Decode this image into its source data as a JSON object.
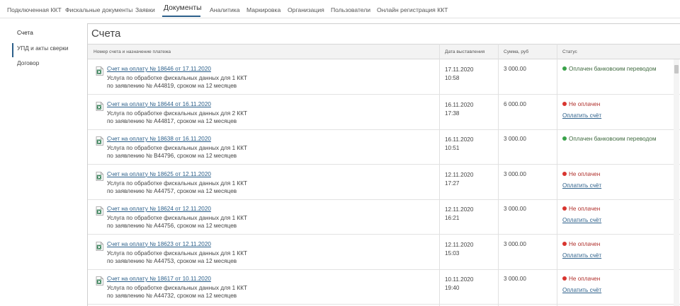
{
  "topnav": {
    "tabs": [
      {
        "label": "Подключенная ККТ"
      },
      {
        "label": "Фискальные документы"
      },
      {
        "label": "Заявки"
      },
      {
        "label": "Документы"
      },
      {
        "label": "Аналитика"
      },
      {
        "label": "Маркировка"
      },
      {
        "label": "Организация"
      },
      {
        "label": "Пользователи"
      },
      {
        "label": "Онлайн регистрация ККТ"
      }
    ],
    "active_tab": "Документы"
  },
  "sidebar": {
    "items": [
      {
        "label": "Счета"
      },
      {
        "label": "УПД и акты сверки"
      },
      {
        "label": "Договор"
      }
    ],
    "active_item": "Счета"
  },
  "main": {
    "title": "Счета",
    "columns": [
      "Номер счета и назначение платежа",
      "Дата выставления",
      "Сумма, руб",
      "Статус"
    ],
    "pay_label": "Оплатить счёт",
    "rows": [
      {
        "invoice": "Счет на оплату № 18646 от 17.11.2020",
        "desc1": "Услуга по обработке фискальных данных для 1 ККТ",
        "desc2": "по заявлению № A44819, сроком на 12 месяцев",
        "date": "17.11.2020",
        "time": "10:58",
        "sum": "3 000.00",
        "status": "Оплачен банковским переводом",
        "paid": true
      },
      {
        "invoice": "Счет на оплату № 18644 от 16.11.2020",
        "desc1": "Услуга по обработке фискальных данных для 2 ККТ",
        "desc2": "по заявлению № A44817, сроком на 12 месяцев",
        "date": "16.11.2020",
        "time": "17:38",
        "sum": "6 000.00",
        "status": "Не оплачен",
        "paid": false
      },
      {
        "invoice": "Счет на оплату № 18638 от 16.11.2020",
        "desc1": "Услуга по обработке фискальных данных для 1 ККТ",
        "desc2": "по заявлению № B44796, сроком на 12 месяцев",
        "date": "16.11.2020",
        "time": "10:51",
        "sum": "3 000.00",
        "status": "Оплачен банковским переводом",
        "paid": true
      },
      {
        "invoice": "Счет на оплату № 18625 от 12.11.2020",
        "desc1": "Услуга по обработке фискальных данных для 1 ККТ",
        "desc2": "по заявлению № A44757, сроком на 12 месяцев",
        "date": "12.11.2020",
        "time": "17:27",
        "sum": "3 000.00",
        "status": "Не оплачен",
        "paid": false
      },
      {
        "invoice": "Счет на оплату № 18624 от 12.11.2020",
        "desc1": "Услуга по обработке фискальных данных для 1 ККТ",
        "desc2": "по заявлению № A44756, сроком на 12 месяцев",
        "date": "12.11.2020",
        "time": "16:21",
        "sum": "3 000.00",
        "status": "Не оплачен",
        "paid": false
      },
      {
        "invoice": "Счет на оплату № 18623 от 12.11.2020",
        "desc1": "Услуга по обработке фискальных данных для 1 ККТ",
        "desc2": "по заявлению № A44753, сроком на 12 месяцев",
        "date": "12.11.2020",
        "time": "15:03",
        "sum": "3 000.00",
        "status": "Не оплачен",
        "paid": false
      },
      {
        "invoice": "Счет на оплату № 18617 от 10.11.2020",
        "desc1": "Услуга по обработке фискальных данных для 1 ККТ",
        "desc2": "по заявлению № A44732, сроком на 12 месяцев",
        "date": "10.11.2020",
        "time": "19:40",
        "sum": "3 000.00",
        "status": "Не оплачен",
        "paid": false
      }
    ]
  },
  "icons": {
    "excel": "excel-file-icon",
    "paid_dot": "status-paid-dot-icon",
    "unpaid_dot": "status-unpaid-dot-icon"
  },
  "colors": {
    "accent": "#2b5f8a",
    "paid": "#3aa24a",
    "unpaid": "#d8352f",
    "excel": "#1f7244"
  }
}
